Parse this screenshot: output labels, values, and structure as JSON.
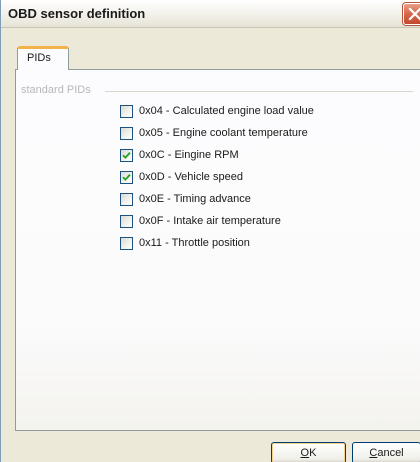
{
  "window": {
    "title": "OBD sensor definition"
  },
  "tabs": [
    {
      "label": "PIDs",
      "selected": true
    }
  ],
  "group": {
    "label": "standard PIDs"
  },
  "pids": [
    {
      "label": "0x04 - Calculated engine load value",
      "checked": false
    },
    {
      "label": "0x05 - Engine coolant temperature",
      "checked": false
    },
    {
      "label": "0x0C - Eingine RPM",
      "checked": true
    },
    {
      "label": "0x0D - Vehicle speed",
      "checked": true
    },
    {
      "label": "0x0E - Timing advance",
      "checked": false
    },
    {
      "label": "0x0F - Intake air temperature",
      "checked": false
    },
    {
      "label": "0x11 - Throttle position",
      "checked": false
    }
  ],
  "buttons": {
    "ok_accel": "O",
    "ok_rest": "K",
    "cancel_accel": "C",
    "cancel_rest": "ancel"
  },
  "colors": {
    "window_bg": "#ECE9D8",
    "tab_highlight": "#f2b24a",
    "checkmark": "#21a121",
    "close_button": "#d7664a"
  }
}
